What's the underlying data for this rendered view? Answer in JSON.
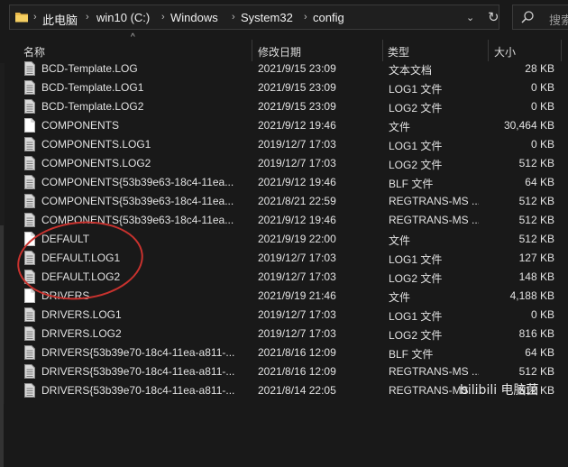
{
  "address": {
    "crumbs": [
      "此电脑",
      "win10 (C:)",
      "Windows",
      "System32",
      "config"
    ],
    "search_placeholder": "搜索"
  },
  "columns": {
    "name": "名称",
    "date": "修改日期",
    "type": "类型",
    "size": "大小"
  },
  "files": [
    {
      "name": "BCD-Template.LOG",
      "date": "2021/9/15 23:09",
      "type": "文本文档",
      "size": "28 KB",
      "icon": "log-file-icon"
    },
    {
      "name": "BCD-Template.LOG1",
      "date": "2021/9/15 23:09",
      "type": "LOG1 文件",
      "size": "0 KB",
      "icon": "log-file-icon"
    },
    {
      "name": "BCD-Template.LOG2",
      "date": "2021/9/15 23:09",
      "type": "LOG2 文件",
      "size": "0 KB",
      "icon": "log-file-icon"
    },
    {
      "name": "COMPONENTS",
      "date": "2021/9/12 19:46",
      "type": "文件",
      "size": "30,464 KB",
      "icon": "blank-file-icon"
    },
    {
      "name": "COMPONENTS.LOG1",
      "date": "2019/12/7 17:03",
      "type": "LOG1 文件",
      "size": "0 KB",
      "icon": "log-file-icon"
    },
    {
      "name": "COMPONENTS.LOG2",
      "date": "2019/12/7 17:03",
      "type": "LOG2 文件",
      "size": "512 KB",
      "icon": "log-file-icon"
    },
    {
      "name": "COMPONENTS{53b39e63-18c4-11ea...",
      "date": "2021/9/12 19:46",
      "type": "BLF 文件",
      "size": "64 KB",
      "icon": "log-file-icon"
    },
    {
      "name": "COMPONENTS{53b39e63-18c4-11ea...",
      "date": "2021/8/21 22:59",
      "type": "REGTRANS-MS ...",
      "size": "512 KB",
      "icon": "log-file-icon"
    },
    {
      "name": "COMPONENTS{53b39e63-18c4-11ea...",
      "date": "2021/9/12 19:46",
      "type": "REGTRANS-MS ...",
      "size": "512 KB",
      "icon": "log-file-icon"
    },
    {
      "name": "DEFAULT",
      "date": "2021/9/19 22:00",
      "type": "文件",
      "size": "512 KB",
      "icon": "blank-file-icon"
    },
    {
      "name": "DEFAULT.LOG1",
      "date": "2019/12/7 17:03",
      "type": "LOG1 文件",
      "size": "127 KB",
      "icon": "log-file-icon"
    },
    {
      "name": "DEFAULT.LOG2",
      "date": "2019/12/7 17:03",
      "type": "LOG2 文件",
      "size": "148 KB",
      "icon": "log-file-icon"
    },
    {
      "name": "DRIVERS",
      "date": "2021/9/19 21:46",
      "type": "文件",
      "size": "4,188 KB",
      "icon": "blank-file-icon"
    },
    {
      "name": "DRIVERS.LOG1",
      "date": "2019/12/7 17:03",
      "type": "LOG1 文件",
      "size": "0 KB",
      "icon": "log-file-icon"
    },
    {
      "name": "DRIVERS.LOG2",
      "date": "2019/12/7 17:03",
      "type": "LOG2 文件",
      "size": "816 KB",
      "icon": "log-file-icon"
    },
    {
      "name": "DRIVERS{53b39e70-18c4-11ea-a811-...",
      "date": "2021/8/16 12:09",
      "type": "BLF 文件",
      "size": "64 KB",
      "icon": "log-file-icon"
    },
    {
      "name": "DRIVERS{53b39e70-18c4-11ea-a811-...",
      "date": "2021/8/16 12:09",
      "type": "REGTRANS-MS ...",
      "size": "512 KB",
      "icon": "log-file-icon"
    },
    {
      "name": "DRIVERS{53b39e70-18c4-11ea-a811-...",
      "date": "2021/8/14 22:05",
      "type": "REGTRANS-MS ...",
      "size": "512 KB",
      "icon": "log-file-icon"
    }
  ],
  "watermark": "bilibili 电脑菌",
  "colors": {
    "background": "#191919",
    "text": "#e2e2e2",
    "annotation": "#c8322e"
  }
}
